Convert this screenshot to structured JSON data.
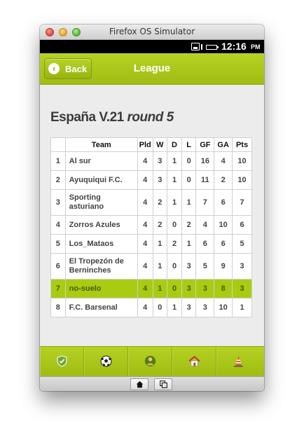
{
  "window": {
    "title": "Firefox OS Simulator"
  },
  "status_bar": {
    "time": "12:16",
    "ampm": "PM"
  },
  "header": {
    "back_label": "Back",
    "title": "League"
  },
  "league": {
    "name": "España V.21",
    "round": "round 5"
  },
  "table": {
    "columns": [
      "",
      "Team",
      "Pld",
      "W",
      "D",
      "L",
      "GF",
      "GA",
      "Pts"
    ],
    "rows": [
      [
        "1",
        "Al sur",
        "4",
        "3",
        "1",
        "0",
        "16",
        "4",
        "10"
      ],
      [
        "2",
        "Ayuquiqui F.C.",
        "4",
        "3",
        "1",
        "0",
        "11",
        "2",
        "10"
      ],
      [
        "3",
        "Sporting asturiano",
        "4",
        "2",
        "1",
        "1",
        "7",
        "6",
        "7"
      ],
      [
        "4",
        "Zorros Azules",
        "4",
        "2",
        "0",
        "2",
        "4",
        "10",
        "6"
      ],
      [
        "5",
        "Los_Mataos",
        "4",
        "1",
        "2",
        "1",
        "6",
        "6",
        "5"
      ],
      [
        "6",
        "El Tropezón de Berninches",
        "4",
        "1",
        "0",
        "3",
        "5",
        "9",
        "3"
      ],
      [
        "7",
        "no-suelo",
        "4",
        "1",
        "0",
        "3",
        "3",
        "8",
        "3"
      ],
      [
        "8",
        "F.C. Barsenal",
        "4",
        "0",
        "1",
        "3",
        "3",
        "10",
        "1"
      ]
    ],
    "highlight_color": "#a9cc12"
  },
  "tabs": [
    {
      "icon": "shield-icon"
    },
    {
      "icon": "soccer-ball-icon"
    },
    {
      "icon": "player-icon"
    },
    {
      "icon": "home-icon"
    },
    {
      "icon": "cone-icon"
    }
  ],
  "bottom_bar": [
    {
      "icon": "home-icon"
    },
    {
      "icon": "windows-icon"
    }
  ],
  "colors": {
    "accent": "#a9cc12",
    "header": "#a6c31a",
    "window": "#ececec"
  }
}
